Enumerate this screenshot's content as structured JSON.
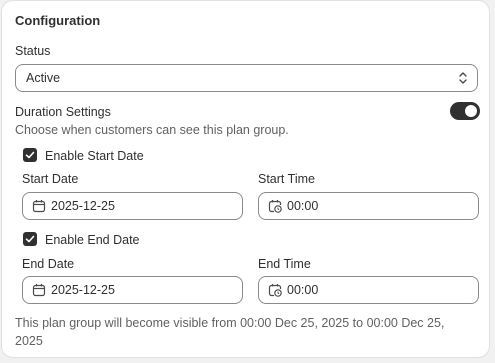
{
  "section": {
    "title": "Configuration"
  },
  "status": {
    "label": "Status",
    "value": "Active"
  },
  "duration": {
    "title": "Duration Settings",
    "help": "Choose when customers can see this plan group.",
    "enabled": true
  },
  "start": {
    "enable_label": "Enable Start Date",
    "enabled": true,
    "date_label": "Start Date",
    "date_value": "2025-12-25",
    "time_label": "Start Time",
    "time_value": "00:00"
  },
  "end": {
    "enable_label": "Enable End Date",
    "enabled": true,
    "date_label": "End Date",
    "date_value": "2025-12-25",
    "time_label": "End Time",
    "time_value": "00:00"
  },
  "summary": "This plan group will become visible from 00:00 Dec 25, 2025 to 00:00 Dec 25, 2025",
  "icons": {
    "status_select": "chevron-up-down-icon",
    "date": "calendar-icon",
    "time": "calendar-clock-icon",
    "checkbox": "checkmark-icon"
  }
}
